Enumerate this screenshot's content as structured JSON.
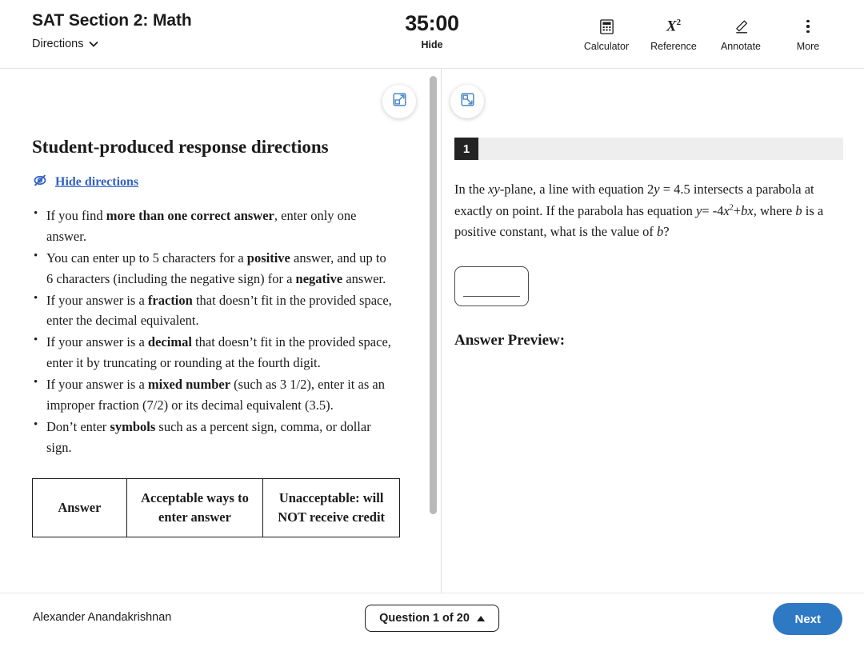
{
  "header": {
    "test_title": "SAT Section 2: Math",
    "directions_label": "Directions",
    "timer": "35:00",
    "timer_toggle": "Hide",
    "tools": [
      {
        "label": "Calculator",
        "icon": "calculator-icon"
      },
      {
        "label": "Reference",
        "icon": "reference-x-squared-icon"
      },
      {
        "label": "Annotate",
        "icon": "pencil-annotate-icon"
      },
      {
        "label": "More",
        "icon": "more-vertical-icon"
      }
    ]
  },
  "directions": {
    "heading": "Student-produced response directions",
    "hide_link": "Hide directions",
    "bullets": [
      {
        "pre": "If you find ",
        "bold": "more than one correct answer",
        "post": ", enter only one answer."
      },
      {
        "pre": "You can enter up to 5 characters for a ",
        "bold": "positive",
        "post": " answer, and up to 6 characters (including the negative sign) for a ",
        "bold2": "negative",
        "post2": " answer."
      },
      {
        "pre": " If your answer is a ",
        "bold": "fraction",
        "post": " that doesn’t fit in the provided space, enter the decimal equivalent."
      },
      {
        "pre": " If your answer is a ",
        "bold": "decimal",
        "post": " that doesn’t fit in the provided space, enter it by truncating or rounding at the fourth digit."
      },
      {
        "pre": " If your answer is a ",
        "bold": "mixed number",
        "post": " (such as 3 1/2), enter it as an improper fraction (7/2) or its decimal equivalent (3.5)."
      },
      {
        "pre": "Don’t enter ",
        "bold": "symbols",
        "post": " such as a percent sign, comma, or dollar sign."
      }
    ],
    "table": {
      "headers": [
        "Answer",
        "Acceptable ways to enter answer",
        "Unacceptable: will NOT receive credit"
      ]
    }
  },
  "panel_controls": {
    "expand_left": "expand-left-panel-icon",
    "expand_right": "collapse-right-panel-icon"
  },
  "question": {
    "number": "1",
    "text_part1": "In the ",
    "xy": "xy",
    "text_part2": "-plane, a line with equation 2",
    "y1": "y",
    "text_part3": " = 4.5 intersects a parabola at exactly on point. If the parabola has equation ",
    "y2": "y",
    "text_part4": "= -4",
    "x1": "x",
    "sup2": "2",
    "text_part5": "+",
    "b1": "b",
    "x2": "x",
    "text_part6": ", where ",
    "b2": "b",
    "text_part7": " is a positive constant, what is the value of ",
    "b3": "b",
    "text_part8": "?",
    "answer_value": "",
    "answer_preview_label": "Answer Preview:"
  },
  "footer": {
    "student_name": "Alexander Anandakrishnan",
    "question_nav": "Question 1 of 20",
    "next_label": "Next"
  },
  "colors": {
    "accent_blue": "#2e79c4",
    "link_blue": "#3261c4",
    "badge_dark": "#232323",
    "bar_gray": "#eeeeee"
  }
}
